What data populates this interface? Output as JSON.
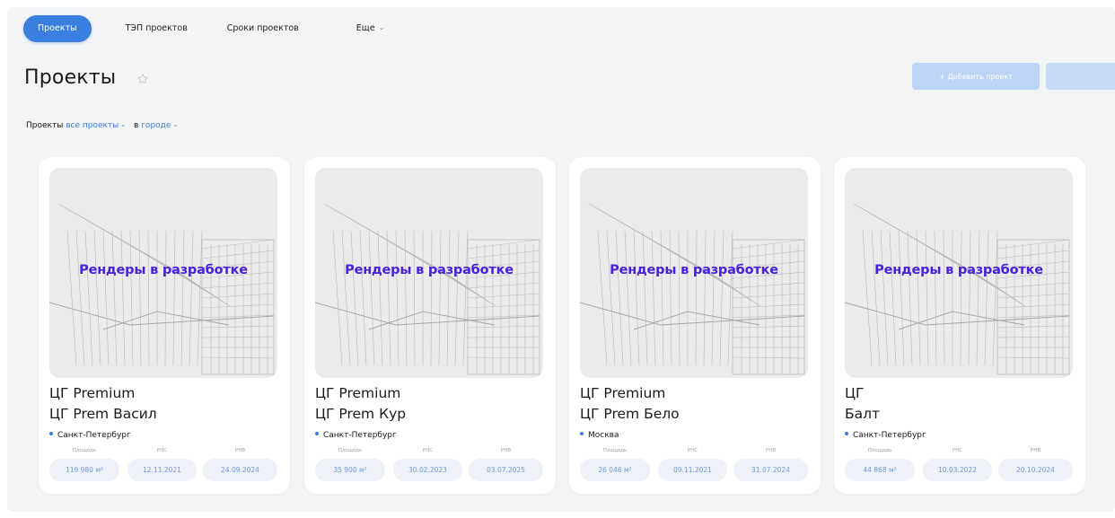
{
  "nav": {
    "tabs": [
      {
        "label": "Проекты",
        "active": true
      },
      {
        "label": "ТЭП проектов"
      },
      {
        "label": "Сроки проектов"
      },
      {
        "label": "Еще"
      }
    ]
  },
  "page": {
    "title": "Проекты",
    "add_button_label": "+ Добавить проект"
  },
  "filters": {
    "prefix": "Проекты",
    "scope": "все проекты",
    "in_label": "в",
    "location": "городе"
  },
  "placeholder_label": "Рендеры в разработке",
  "stat_labels": {
    "area": "Площадь",
    "rns": "РНС",
    "rnv": "РНВ"
  },
  "projects": [
    {
      "line1": "ЦГ Premium",
      "line2": "ЦГ Prem Васил",
      "city": "Санкт-Петербург",
      "area": "119 980 м²",
      "rns": "12.11.2021",
      "rnv": "24.09.2024"
    },
    {
      "line1": "ЦГ Premium",
      "line2": "ЦГ Prem Кур",
      "city": "Санкт-Петербург",
      "area": "35 900 м²",
      "rns": "30.02.2023",
      "rnv": "03.07.2025"
    },
    {
      "line1": "ЦГ Premium",
      "line2": "ЦГ Prem Бело",
      "city": "Москва",
      "area": "26 046 м²",
      "rns": "09.11.2021",
      "rnv": "31.07.2024"
    },
    {
      "line1": "ЦГ",
      "line2": "Балт",
      "city": "Санкт-Петербург",
      "area": "44 868 м²",
      "rns": "10.03.2022",
      "rnv": "20.10.2024"
    }
  ],
  "colors": {
    "accent": "#3a7fe0",
    "render_label": "#4a1fe0",
    "stat_pill_bg": "#eef2f8",
    "stat_pill_text": "#6f98d8"
  },
  "icons": {
    "favorite": "star-icon",
    "dropdown": "chevron-down-icon",
    "location": "dot-icon"
  }
}
